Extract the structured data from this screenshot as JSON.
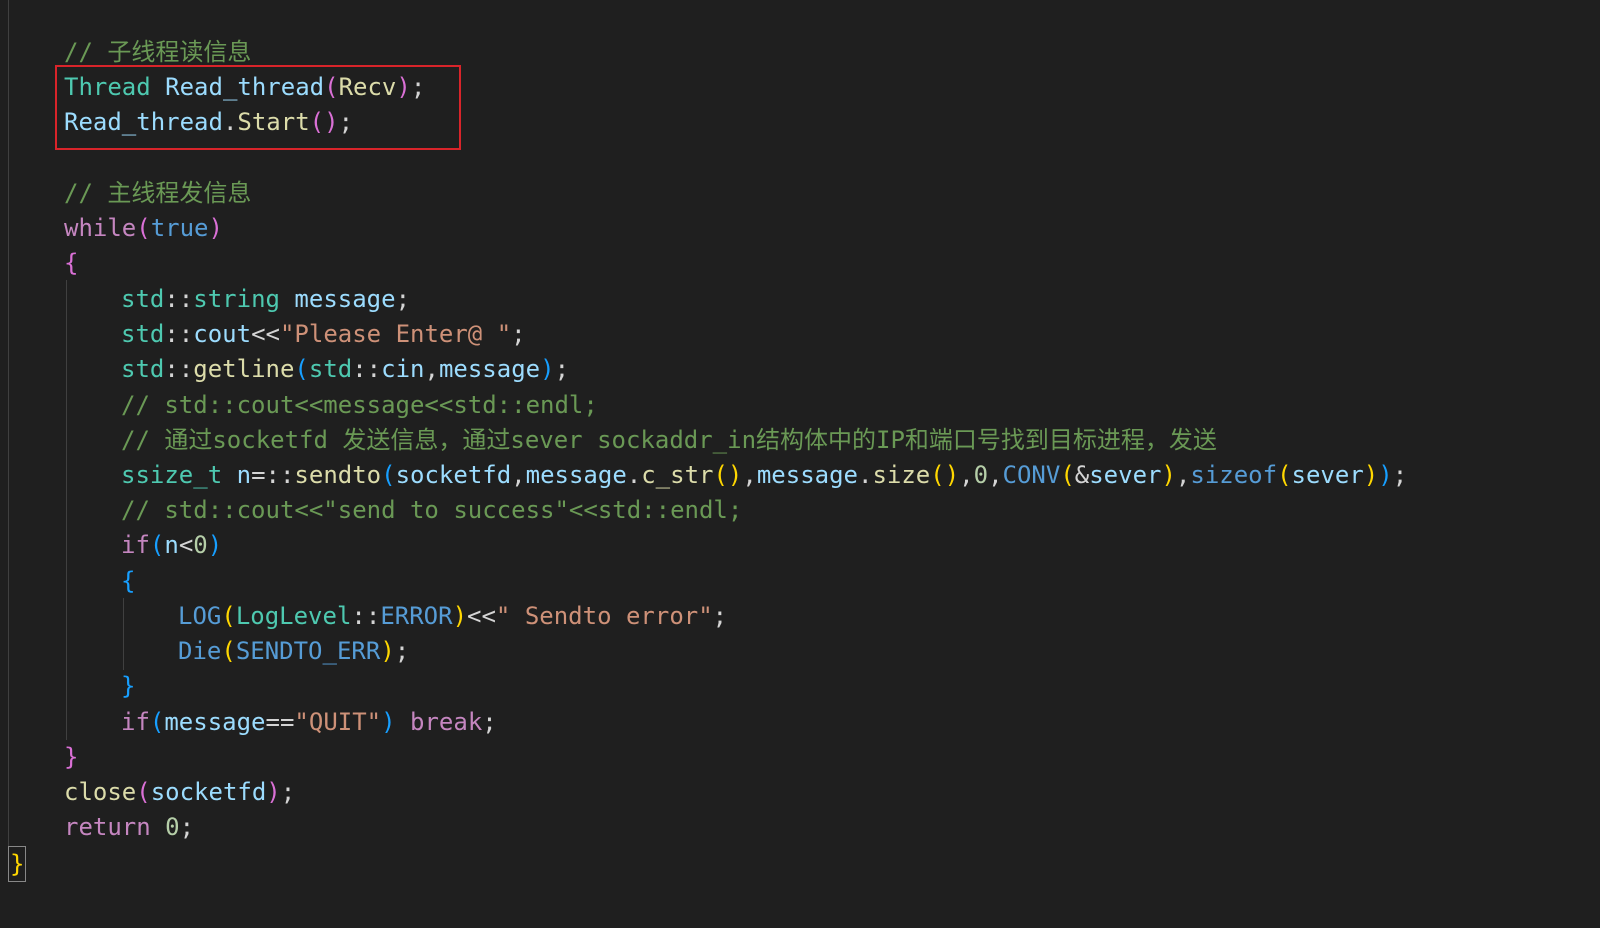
{
  "editor": {
    "lines": [
      {
        "tokens": [
          {
            "t": "// 子线程读信息",
            "c": "comment"
          }
        ]
      },
      {
        "tokens": [
          {
            "t": "Thread",
            "c": "type"
          },
          {
            "t": " ",
            "c": "punct"
          },
          {
            "t": "Read_thread",
            "c": "var"
          },
          {
            "t": "(",
            "c": "brace2"
          },
          {
            "t": "Recv",
            "c": "func"
          },
          {
            "t": ")",
            "c": "brace2"
          },
          {
            "t": ";",
            "c": "punct"
          }
        ]
      },
      {
        "tokens": [
          {
            "t": "Read_thread",
            "c": "var"
          },
          {
            "t": ".",
            "c": "punct"
          },
          {
            "t": "Start",
            "c": "func"
          },
          {
            "t": "()",
            "c": "brace2"
          },
          {
            "t": ";",
            "c": "punct"
          }
        ]
      },
      {
        "tokens": []
      },
      {
        "tokens": [
          {
            "t": "// 主线程发信息",
            "c": "comment"
          }
        ]
      },
      {
        "tokens": [
          {
            "t": "while",
            "c": "keyword"
          },
          {
            "t": "(",
            "c": "brace2"
          },
          {
            "t": "true",
            "c": "const"
          },
          {
            "t": ")",
            "c": "brace2"
          }
        ]
      },
      {
        "tokens": [
          {
            "t": "{",
            "c": "brace2"
          }
        ]
      },
      {
        "tokens": [
          {
            "t": "std",
            "c": "type"
          },
          {
            "t": "::",
            "c": "punct"
          },
          {
            "t": "string",
            "c": "type"
          },
          {
            "t": " ",
            "c": "punct"
          },
          {
            "t": "message",
            "c": "var"
          },
          {
            "t": ";",
            "c": "punct"
          }
        ]
      },
      {
        "tokens": [
          {
            "t": "std",
            "c": "type"
          },
          {
            "t": "::",
            "c": "punct"
          },
          {
            "t": "cout",
            "c": "var"
          },
          {
            "t": "<<",
            "c": "punct"
          },
          {
            "t": "\"Please Enter@ \"",
            "c": "string"
          },
          {
            "t": ";",
            "c": "punct"
          }
        ]
      },
      {
        "tokens": [
          {
            "t": "std",
            "c": "type"
          },
          {
            "t": "::",
            "c": "punct"
          },
          {
            "t": "getline",
            "c": "func"
          },
          {
            "t": "(",
            "c": "brace3"
          },
          {
            "t": "std",
            "c": "type"
          },
          {
            "t": "::",
            "c": "punct"
          },
          {
            "t": "cin",
            "c": "var"
          },
          {
            "t": ",",
            "c": "punct"
          },
          {
            "t": "message",
            "c": "var"
          },
          {
            "t": ")",
            "c": "brace3"
          },
          {
            "t": ";",
            "c": "punct"
          }
        ]
      },
      {
        "tokens": [
          {
            "t": "// std::cout<<message<<std::endl;",
            "c": "comment"
          }
        ]
      },
      {
        "tokens": [
          {
            "t": "// 通过socketfd 发送信息，通过sever sockaddr_in结构体中的IP和端口号找到目标进程，发送",
            "c": "comment"
          }
        ]
      },
      {
        "tokens": [
          {
            "t": "ssize_t",
            "c": "type"
          },
          {
            "t": " ",
            "c": "punct"
          },
          {
            "t": "n",
            "c": "var"
          },
          {
            "t": "=::",
            "c": "punct"
          },
          {
            "t": "sendto",
            "c": "func"
          },
          {
            "t": "(",
            "c": "brace3"
          },
          {
            "t": "socketfd",
            "c": "var"
          },
          {
            "t": ",",
            "c": "punct"
          },
          {
            "t": "message",
            "c": "var"
          },
          {
            "t": ".",
            "c": "punct"
          },
          {
            "t": "c_str",
            "c": "func"
          },
          {
            "t": "()",
            "c": "brace1"
          },
          {
            "t": ",",
            "c": "punct"
          },
          {
            "t": "message",
            "c": "var"
          },
          {
            "t": ".",
            "c": "punct"
          },
          {
            "t": "size",
            "c": "func"
          },
          {
            "t": "()",
            "c": "brace1"
          },
          {
            "t": ",",
            "c": "punct"
          },
          {
            "t": "0",
            "c": "num"
          },
          {
            "t": ",",
            "c": "punct"
          },
          {
            "t": "CONV",
            "c": "macro"
          },
          {
            "t": "(",
            "c": "brace1"
          },
          {
            "t": "&",
            "c": "punct"
          },
          {
            "t": "sever",
            "c": "var"
          },
          {
            "t": ")",
            "c": "brace1"
          },
          {
            "t": ",",
            "c": "punct"
          },
          {
            "t": "sizeof",
            "c": "const"
          },
          {
            "t": "(",
            "c": "brace1"
          },
          {
            "t": "sever",
            "c": "var"
          },
          {
            "t": ")",
            "c": "brace1"
          },
          {
            "t": ")",
            "c": "brace3"
          },
          {
            "t": ";",
            "c": "punct"
          }
        ]
      },
      {
        "tokens": [
          {
            "t": "// std::cout<<\"send to success\"<<std::endl;",
            "c": "comment"
          }
        ]
      },
      {
        "tokens": [
          {
            "t": "if",
            "c": "keyword"
          },
          {
            "t": "(",
            "c": "brace3"
          },
          {
            "t": "n",
            "c": "var"
          },
          {
            "t": "<",
            "c": "punct"
          },
          {
            "t": "0",
            "c": "num"
          },
          {
            "t": ")",
            "c": "brace3"
          }
        ]
      },
      {
        "tokens": [
          {
            "t": "{",
            "c": "brace3"
          }
        ]
      },
      {
        "tokens": [
          {
            "t": "LOG",
            "c": "macro"
          },
          {
            "t": "(",
            "c": "brace1"
          },
          {
            "t": "LogLevel",
            "c": "type"
          },
          {
            "t": "::",
            "c": "punct"
          },
          {
            "t": "ERROR",
            "c": "const"
          },
          {
            "t": ")",
            "c": "brace1"
          },
          {
            "t": "<<",
            "c": "punct"
          },
          {
            "t": "\" Sendto error\"",
            "c": "string"
          },
          {
            "t": ";",
            "c": "punct"
          }
        ]
      },
      {
        "tokens": [
          {
            "t": "Die",
            "c": "macro"
          },
          {
            "t": "(",
            "c": "brace1"
          },
          {
            "t": "SENDTO_ERR",
            "c": "const"
          },
          {
            "t": ")",
            "c": "brace1"
          },
          {
            "t": ";",
            "c": "punct"
          }
        ]
      },
      {
        "tokens": [
          {
            "t": "}",
            "c": "brace3"
          }
        ]
      },
      {
        "tokens": [
          {
            "t": "if",
            "c": "keyword"
          },
          {
            "t": "(",
            "c": "brace3"
          },
          {
            "t": "message",
            "c": "var"
          },
          {
            "t": "==",
            "c": "punct"
          },
          {
            "t": "\"QUIT\"",
            "c": "string"
          },
          {
            "t": ")",
            "c": "brace3"
          },
          {
            "t": " ",
            "c": "punct"
          },
          {
            "t": "break",
            "c": "keyword"
          },
          {
            "t": ";",
            "c": "punct"
          }
        ]
      },
      {
        "tokens": [
          {
            "t": "}",
            "c": "brace2"
          }
        ]
      },
      {
        "tokens": [
          {
            "t": "close",
            "c": "func"
          },
          {
            "t": "(",
            "c": "brace2"
          },
          {
            "t": "socketfd",
            "c": "var"
          },
          {
            "t": ")",
            "c": "brace2"
          },
          {
            "t": ";",
            "c": "punct"
          }
        ]
      },
      {
        "tokens": [
          {
            "t": "return",
            "c": "keyword"
          },
          {
            "t": " ",
            "c": "punct"
          },
          {
            "t": "0",
            "c": "num"
          },
          {
            "t": ";",
            "c": "punct"
          }
        ]
      }
    ],
    "closing_brace": "}",
    "highlight_color": "#d9242a"
  }
}
